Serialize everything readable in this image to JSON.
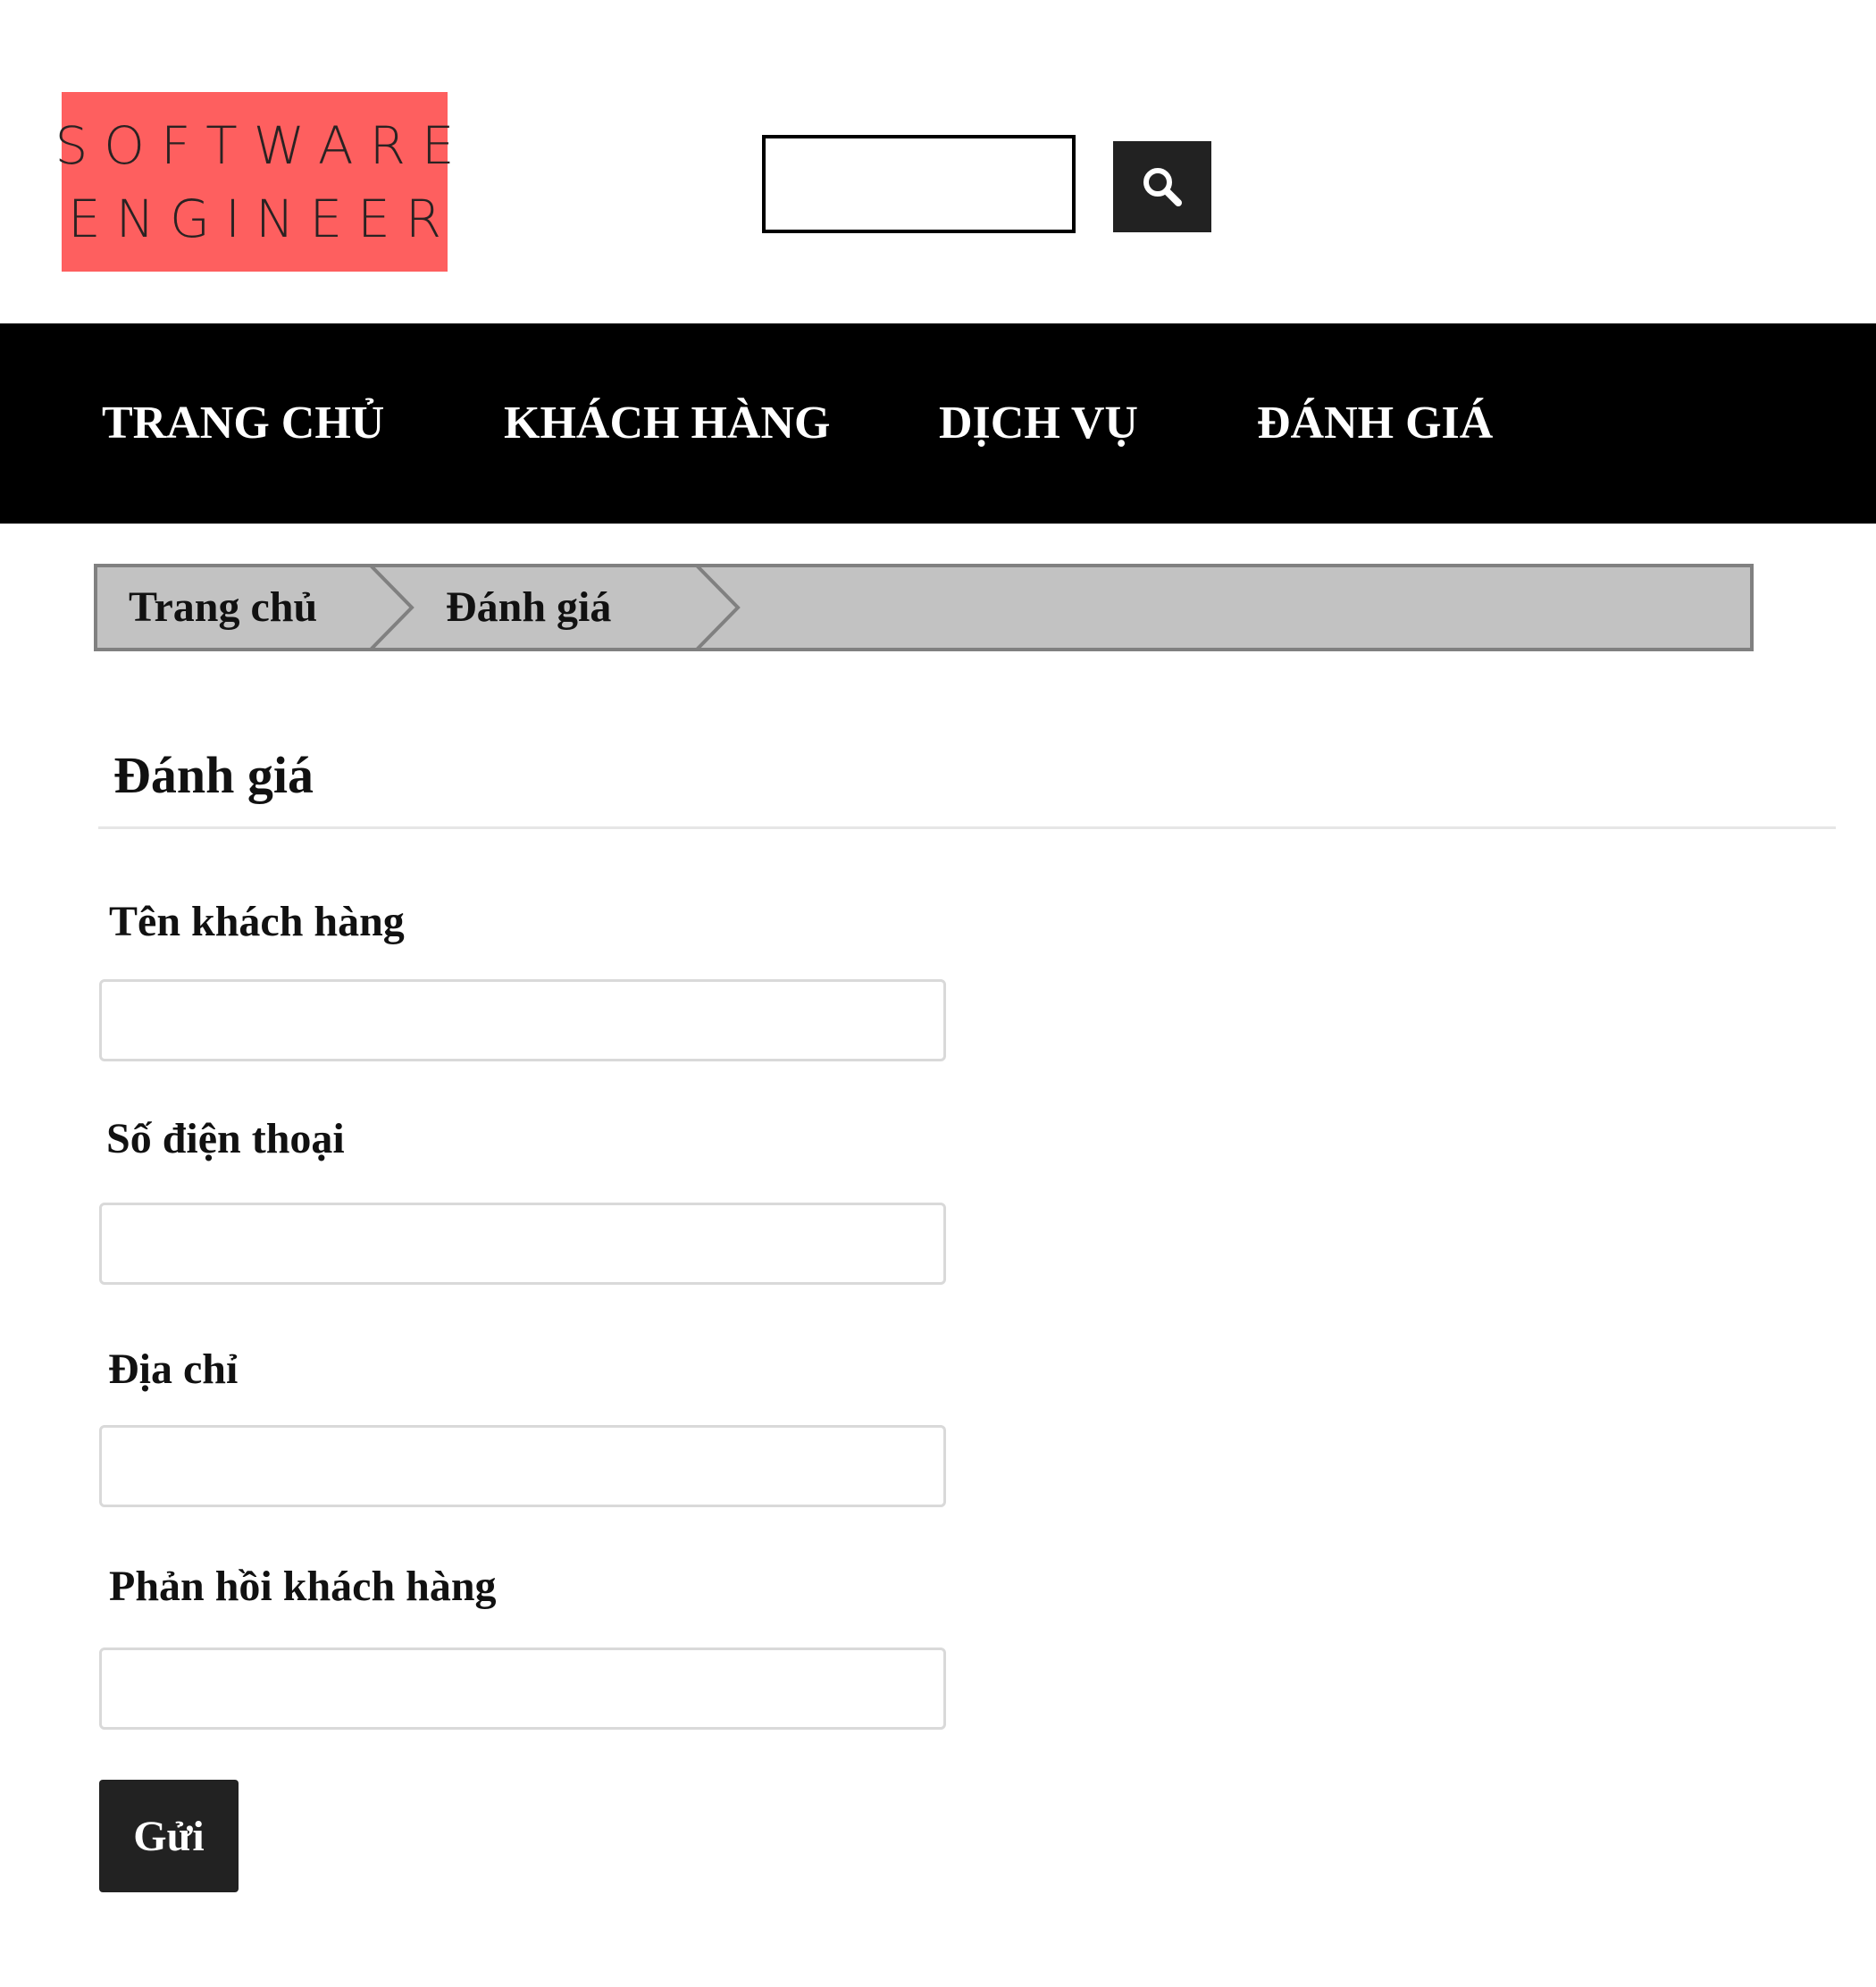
{
  "header": {
    "logo": {
      "line1": "SOFTWARE",
      "line2": "ENGINEER",
      "background_color": "#fe5f5f"
    },
    "search": {
      "value": "",
      "placeholder": "",
      "button_icon": "search-icon"
    }
  },
  "nav": {
    "items": [
      {
        "label": "TRANG CHỦ"
      },
      {
        "label": "KHÁCH HÀNG"
      },
      {
        "label": "DỊCH VỤ"
      },
      {
        "label": "ĐÁNH GIÁ"
      }
    ]
  },
  "breadcrumb": {
    "items": [
      {
        "label": "Trang chủ"
      },
      {
        "label": "Đánh giá"
      }
    ]
  },
  "main": {
    "title": "Đánh giá",
    "fields": [
      {
        "label": "Tên khách hàng",
        "value": ""
      },
      {
        "label": "Số điện thoại",
        "value": ""
      },
      {
        "label": "Địa chỉ",
        "value": ""
      },
      {
        "label": "Phản hồi khách hàng",
        "value": ""
      }
    ],
    "submit_label": "Gửi"
  },
  "colors": {
    "nav_background": "#000000",
    "breadcrumb_background": "#c2c2c2",
    "button_background": "#222222"
  }
}
